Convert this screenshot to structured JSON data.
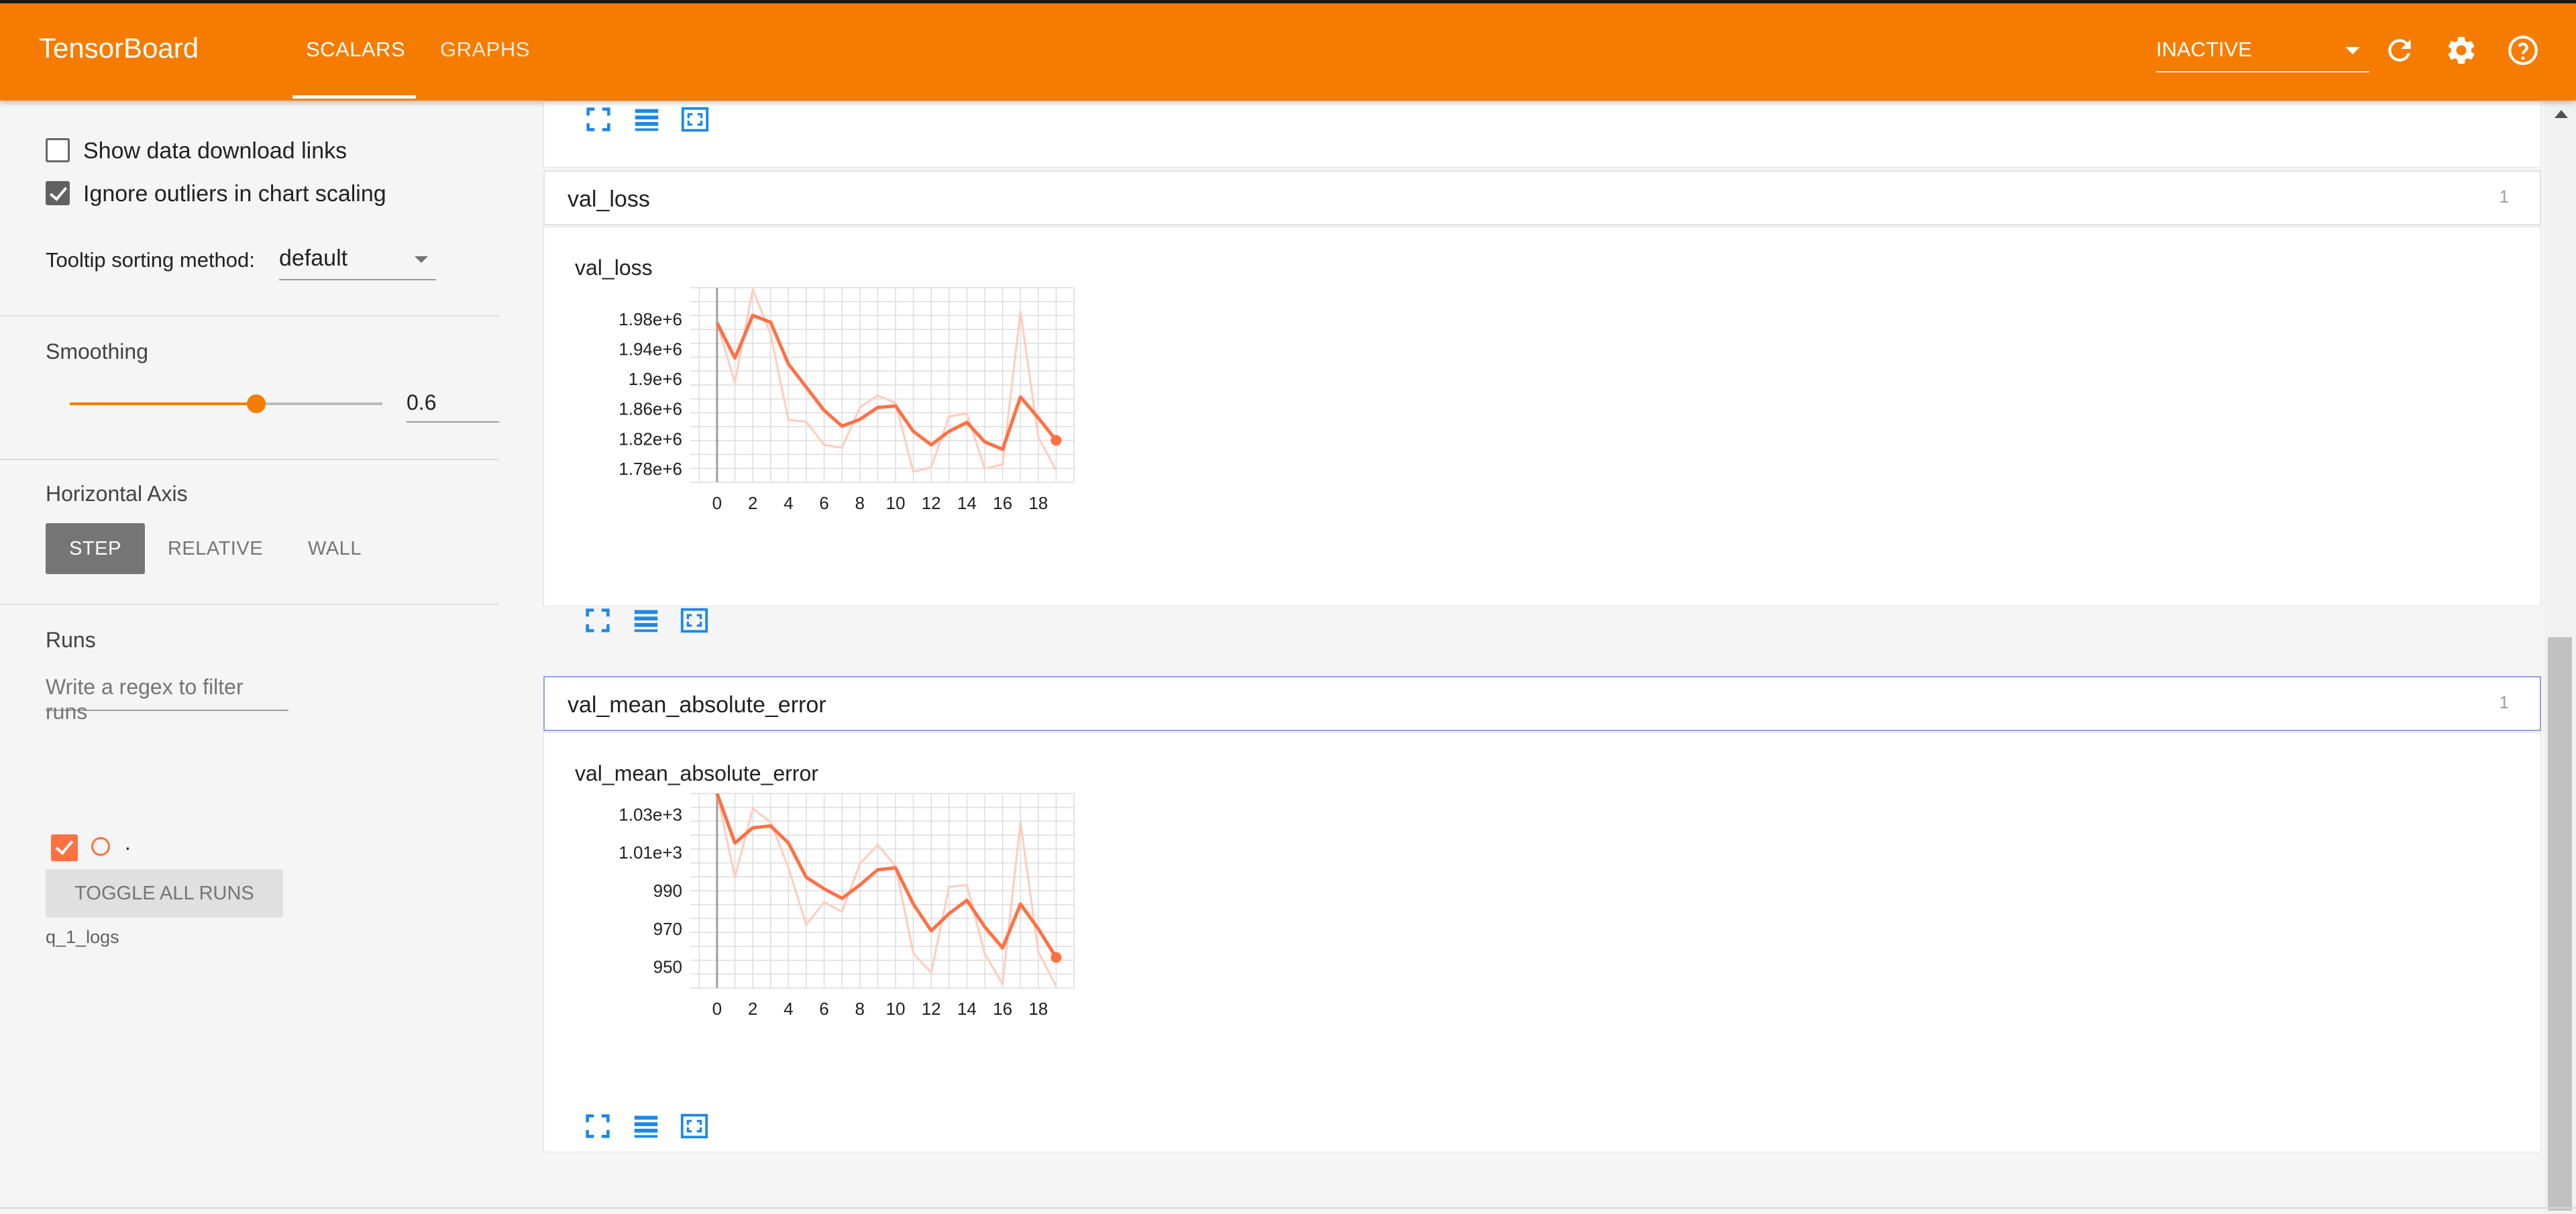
{
  "header": {
    "title": "TensorBoard",
    "tabs": [
      {
        "label": "SCALARS"
      },
      {
        "label": "GRAPHS"
      }
    ],
    "run_status": "INACTIVE",
    "icons": [
      "refresh-icon",
      "settings-icon",
      "help-icon"
    ],
    "bar_color": "#f57c00"
  },
  "sidebar": {
    "show_download_links": "Show data download links",
    "ignore_outliers": "Ignore outliers in chart scaling",
    "tooltip_label": "Tooltip sorting method:",
    "tooltip_value": "default",
    "smoothing_label": "Smoothing",
    "smoothing_value": "0.6",
    "horizontal_axis_label": "Horizontal Axis",
    "axis_buttons": [
      "STEP",
      "RELATIVE",
      "WALL"
    ],
    "runs_label": "Runs",
    "filter_placeholder": "Write a regex to filter runs",
    "run_name": ".",
    "toggle_all_runs": "TOGGLE ALL RUNS",
    "log_dir": "q_1_logs"
  },
  "categories": [
    {
      "name": "val_loss",
      "count": "1",
      "chart_title": "val_loss"
    },
    {
      "name": "val_mean_absolute_error",
      "count": "1",
      "chart_title": "val_mean_absolute_error"
    }
  ],
  "chart_data": [
    {
      "type": "line",
      "title": "val_loss",
      "x": [
        0,
        1,
        2,
        3,
        4,
        5,
        6,
        7,
        8,
        9,
        10,
        11,
        12,
        13,
        14,
        15,
        16,
        17,
        18,
        19
      ],
      "series": [
        {
          "values": [
            1975000,
            1928000,
            1985000,
            1976000,
            1920000,
            1889000,
            1858000,
            1837000,
            1846000,
            1862000,
            1864000,
            1830000,
            1812000,
            1830000,
            1842000,
            1816000,
            1806000,
            1876000,
            1848000,
            1818000
          ]
        },
        {
          "values": [
            1975000,
            1895000,
            2020000,
            1960000,
            1845000,
            1843000,
            1812000,
            1808000,
            1862000,
            1878000,
            1868000,
            1776000,
            1782000,
            1850000,
            1854000,
            1780000,
            1786000,
            1990000,
            1822000,
            1778000
          ]
        }
      ],
      "yticks": [
        "1.98e+6",
        "1.94e+6",
        "1.9e+6",
        "1.86e+6",
        "1.82e+6",
        "1.78e+6"
      ],
      "xticks": [
        "0",
        "2",
        "4",
        "6",
        "8",
        "10",
        "12",
        "14",
        "16",
        "18"
      ],
      "ylim": [
        1762000,
        2022000
      ],
      "xlim": [
        -1.5,
        20
      ],
      "colors": {
        "smoothed": "#ff7043",
        "raw": "#ffccbc"
      }
    },
    {
      "type": "line",
      "title": "val_mean_absolute_error",
      "x": [
        0,
        1,
        2,
        3,
        4,
        5,
        6,
        7,
        8,
        9,
        10,
        11,
        12,
        13,
        14,
        15,
        16,
        17,
        18,
        19
      ],
      "series": [
        {
          "values": [
            1041,
            1015,
            1023,
            1024,
            1015,
            997,
            991,
            986,
            993,
            1001,
            1002,
            983,
            969,
            978,
            985,
            971,
            960,
            983,
            970,
            955
          ]
        },
        {
          "values": [
            1041,
            997,
            1033,
            1026,
            1002,
            972,
            984,
            979,
            1004,
            1014,
            1003,
            957,
            947,
            992,
            993,
            957,
            941,
            1026,
            958,
            940
          ]
        }
      ],
      "yticks": [
        "1.03e+3",
        "1.01e+3",
        "990",
        "970",
        "950"
      ],
      "xticks": [
        "0",
        "2",
        "4",
        "6",
        "8",
        "10",
        "12",
        "14",
        "16",
        "18"
      ],
      "ylim": [
        939,
        1041
      ],
      "xlim": [
        -1.5,
        20
      ],
      "colors": {
        "smoothed": "#ff7043",
        "raw": "#ffccbc"
      }
    }
  ]
}
